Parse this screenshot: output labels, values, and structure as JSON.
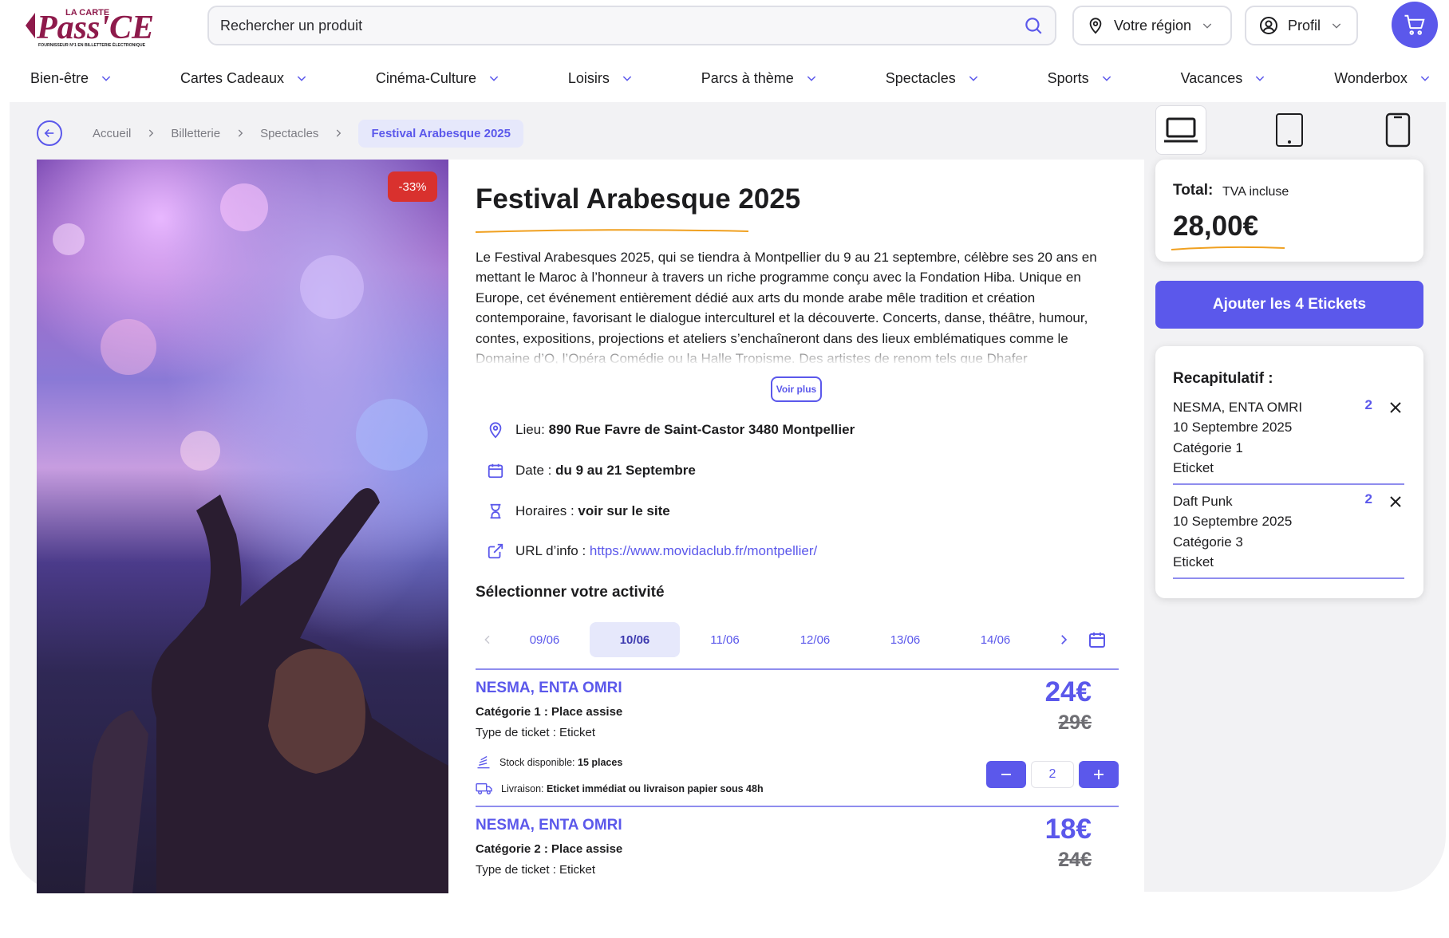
{
  "header": {
    "logo_text_top": "LA CARTE",
    "logo_text_main": "Pass'CE",
    "logo_tagline": "FOURNISSEUR N°1 EN BILLETTERIE ÉLECTRONIQUE",
    "search_placeholder": "Rechercher un produit",
    "region_label": "Votre région",
    "profile_label": "Profil"
  },
  "nav": [
    {
      "label": "Bien-être"
    },
    {
      "label": "Cartes Cadeaux"
    },
    {
      "label": "Cinéma-Culture"
    },
    {
      "label": "Loisirs"
    },
    {
      "label": "Parcs à thème"
    },
    {
      "label": "Spectacles"
    },
    {
      "label": "Sports"
    },
    {
      "label": "Vacances"
    },
    {
      "label": "Wonderbox"
    }
  ],
  "breadcrumb": [
    "Accueil",
    "Billetterie",
    "Spectacles",
    "Festival Arabesque 2025"
  ],
  "product": {
    "discount": "-33%",
    "title": "Festival Arabesque 2025",
    "description": "Le Festival Arabesques 2025, qui se tiendra à Montpellier du 9 au 21 septembre, célèbre ses 20 ans en mettant le Maroc à l’honneur à travers un riche programme conçu avec la Fondation Hiba. Unique en Europe, cet événement entièrement dédié aux arts du monde arabe mêle tradition et création contemporaine, favorisant le dialogue interculturel et la découverte. Concerts, danse, théâtre, humour, contes, expositions, projections et ateliers s’enchaîneront dans des lieux emblématiques comme le Domaine d’O, l’Opéra Comédie ou la Halle Tropisme. Des artistes de renom tels que Dhafer",
    "voir_plus": "Voir plus",
    "lieu_label": "Lieu:",
    "lieu_value": "890 Rue Favre de Saint-Castor 3480 Montpellier",
    "date_label": "Date :",
    "date_value": "du 9 au 21 Septembre",
    "horaires_label": "Horaires :",
    "horaires_value": "voir sur le site",
    "url_label": "URL d’info :",
    "url_value": "https://www.movidaclub.fr/montpellier/"
  },
  "activity": {
    "title": "Sélectionner votre activité",
    "dates": [
      "09/06",
      "10/06",
      "11/06",
      "12/06",
      "13/06",
      "14/06"
    ],
    "selected_date": "10/06"
  },
  "tickets": [
    {
      "name": "NESMA, ENTA OMRI",
      "category": "Catégorie 1 : Place assise",
      "type": "Type de ticket : Eticket",
      "price": "24€",
      "old_price": "29€",
      "stock_label": "Stock disponible:",
      "stock_value": "15 places",
      "delivery_label": "Livraison:",
      "delivery_value": "Eticket immédiat ou livraison papier sous 48h",
      "quantity": "2"
    },
    {
      "name": "NESMA, ENTA OMRI",
      "category": "Catégorie 2 : Place assise",
      "type": "Type de ticket : Eticket",
      "price": "18€",
      "old_price": "24€"
    }
  ],
  "summary": {
    "total_label": "Total:",
    "total_tva": "TVA incluse",
    "total_amount": "28,00€",
    "add_button": "Ajouter les 4 Etickets",
    "recap_title": "Recapitulatif :",
    "items": [
      {
        "name": "NESMA, ENTA OMRI",
        "date": "10 Septembre 2025",
        "category": "Catégorie 1",
        "type": "Eticket",
        "count": "2"
      },
      {
        "name": "Daft Punk",
        "date": "10 Septembre 2025",
        "category": "Catégorie 3",
        "type": "Eticket",
        "count": "2"
      }
    ]
  },
  "colors": {
    "accent": "#5b58eb",
    "discount_badge": "#d9312e",
    "underline": "#f0a020",
    "panel_bg": "#f2f2f4"
  }
}
